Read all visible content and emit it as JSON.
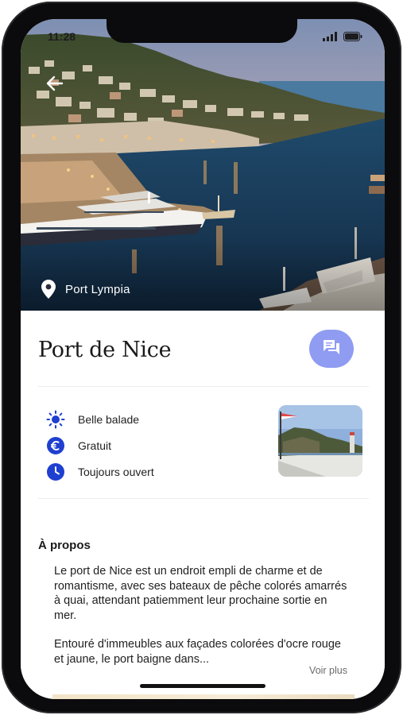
{
  "status_bar": {
    "time": "11:28",
    "signal_icon": "cellular-signal-icon",
    "battery_icon": "battery-icon"
  },
  "hero": {
    "back_icon": "arrow-left-icon",
    "location_icon": "map-pin-icon",
    "location_label": "Port Lympia"
  },
  "place": {
    "title": "Port de Nice",
    "chat_icon": "chat-bubbles-icon"
  },
  "info_items": [
    {
      "icon": "sun-icon",
      "label": "Belle balade"
    },
    {
      "icon": "euro-icon",
      "label": "Gratuit"
    },
    {
      "icon": "clock-icon",
      "label": "Toujours ouvert"
    }
  ],
  "about": {
    "title": "À propos",
    "paragraph_1": "Le port de Nice est un endroit empli de charme et de romantisme, avec ses bateaux de pêche colorés amarrés à quai, attendant patiemment leur prochaine sortie en mer.",
    "paragraph_2": "Entouré d'immeubles aux façades colorées d'ocre rouge et jaune, le port baigne dans...",
    "see_more": "Voir plus"
  },
  "colors": {
    "accent": "#8f9cf2",
    "icon_blue": "#1e3fd0",
    "text": "#1f1f1f",
    "divider": "#ececef"
  }
}
